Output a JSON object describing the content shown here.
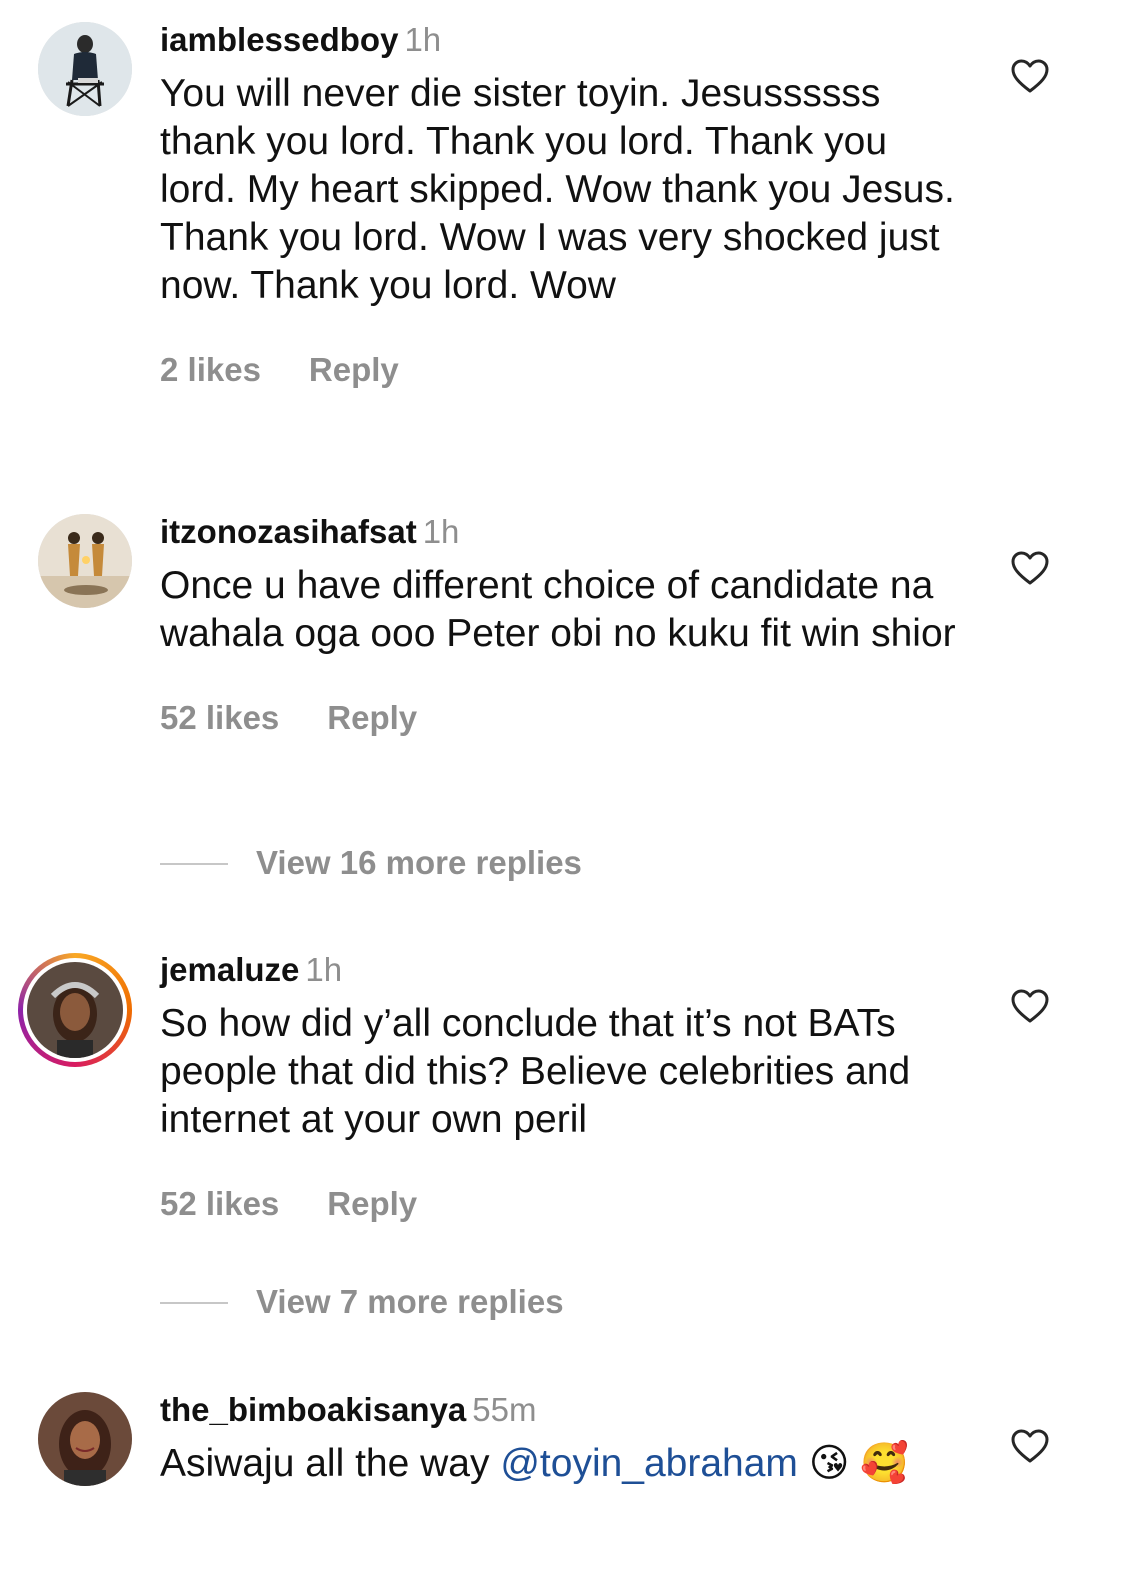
{
  "comments": [
    {
      "username": "iamblessedboy",
      "time": "1h",
      "text": "You will never die sister toyin. Jesussssss thank you lord. Thank you lord. Thank you lord. My heart skipped. Wow thank you Jesus. Thank you lord. Wow I was very shocked just now. Thank you lord. Wow",
      "likes": "2 likes",
      "reply": "Reply"
    },
    {
      "username": "itzonozasihafsat",
      "time": "1h",
      "text": "Once u have different choice of candidate na wahala oga ooo Peter obi no kuku fit win shior",
      "likes": "52 likes",
      "reply": "Reply",
      "view_replies": "View 16 more replies"
    },
    {
      "username": "jemaluze",
      "time": "1h",
      "text": "So how did y’all conclude that it’s not BATs people that did this? Believe celebrities and internet at your own peril",
      "likes": "52 likes",
      "reply": "Reply",
      "view_replies": "View 7 more replies"
    },
    {
      "username": "the_bimboakisanya",
      "time": "55m",
      "text_before": "Asiwaju all the way ",
      "mention": "@toyin_abraham",
      "text_after": " 😘 🥰"
    }
  ],
  "colors": {
    "secondary_text": "#8e8e8e",
    "mention": "#1e4f96",
    "story_ring": "#d81b60"
  },
  "icons": {
    "like": "heart-outline-icon"
  }
}
